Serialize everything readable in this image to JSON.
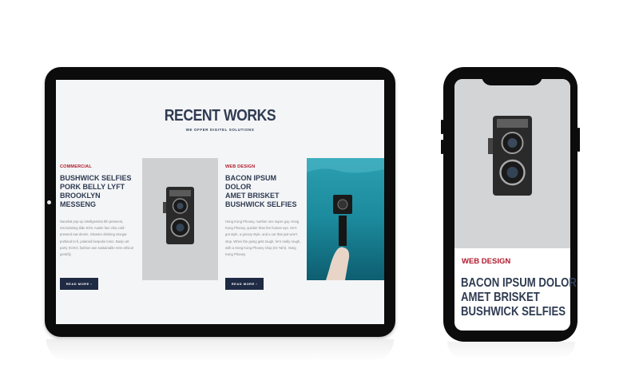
{
  "tablet": {
    "title": "RECENT WORKS",
    "subtitle": "WE OFFER DIGITEL SOLUTIONS",
    "cards": [
      {
        "category": "COMMERCIAL",
        "heading_lines": [
          "BUSHWICK SELFIES",
          "PORK BELLY LYFT",
          "BROOKLYN MESSENG"
        ],
        "paragraph": "Narwhal pop-up intelligentsia tbh pinterest, microdosing tilde 8-bit. Austin fam chia cold-pressed raw denim. Glossier drinking vinegar portland lo-fi, polaroid bespoke lomo. Banjo art party XOXO, fashion axe sustainable retro ethical gentrify.",
        "button": "READ MORE ›"
      },
      {
        "category": "WEB DESIGN",
        "heading_lines": [
          "BACON IPSUM DOLOR",
          "AMET BRISKET",
          "BUSHWICK SELFIES"
        ],
        "paragraph": "Hong Kong Phooey, number one super guy. Hong Kong Phooey, quicker than the human eye. He's got style, a groovy style, and a car that just won't stop. When the going gets tough, he's really rough, with a Hong Kong Phooey chop (Hi-Yah!). Hong Kong Phooey.",
        "button": "READ MORE ›"
      }
    ]
  },
  "phone": {
    "category": "WEB DESIGN",
    "heading_lines": [
      "BACON IPSUM DOLOR",
      "AMET BRISKET",
      "BUSHWICK SELFIES"
    ]
  },
  "colors": {
    "accent_red": "#b01a2b",
    "navy": "#2f3b52",
    "button_navy": "#1f2a44",
    "device_frame": "#0c0c0c"
  },
  "icons": [
    "camera-image",
    "underwater-action-camera-image",
    "chevron-right-icon"
  ]
}
